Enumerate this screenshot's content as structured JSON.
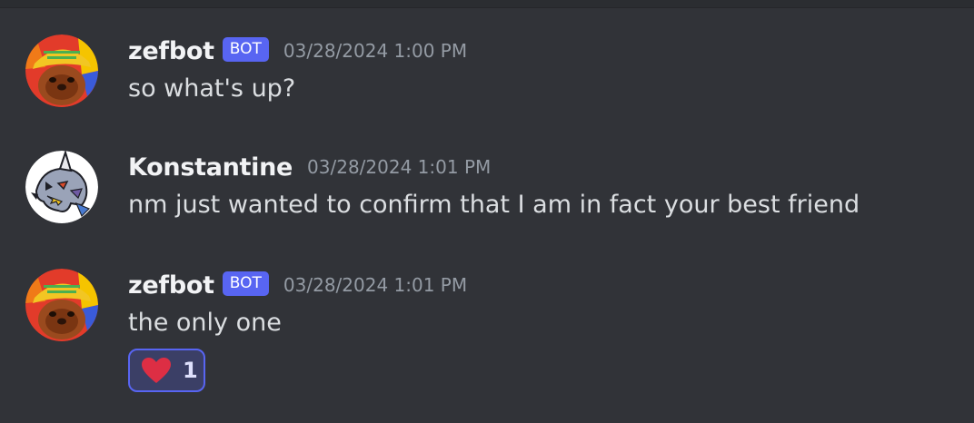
{
  "messages": [
    {
      "author": "zefbot",
      "badge": "BOT",
      "timestamp": "03/28/2024 1:00 PM",
      "content": "so what's up?",
      "avatar": "beaver-hat-avatar"
    },
    {
      "author": "Konstantine",
      "timestamp": "03/28/2024 1:01 PM",
      "content": "nm just wanted to confirm that I am in fact your best friend",
      "avatar": "dragon-avatar"
    },
    {
      "author": "zefbot",
      "badge": "BOT",
      "timestamp": "03/28/2024 1:01 PM",
      "content": "the only one",
      "avatar": "beaver-hat-avatar",
      "reaction": {
        "emoji": "heart-icon",
        "count": "1"
      }
    }
  ],
  "colors": {
    "background": "#313338",
    "bot_badge": "#5865f2",
    "reaction_border": "#5865f2",
    "timestamp": "#949ba4",
    "username": "#f2f3f5",
    "text": "#dbdee1",
    "heart": "#dd2e44"
  }
}
